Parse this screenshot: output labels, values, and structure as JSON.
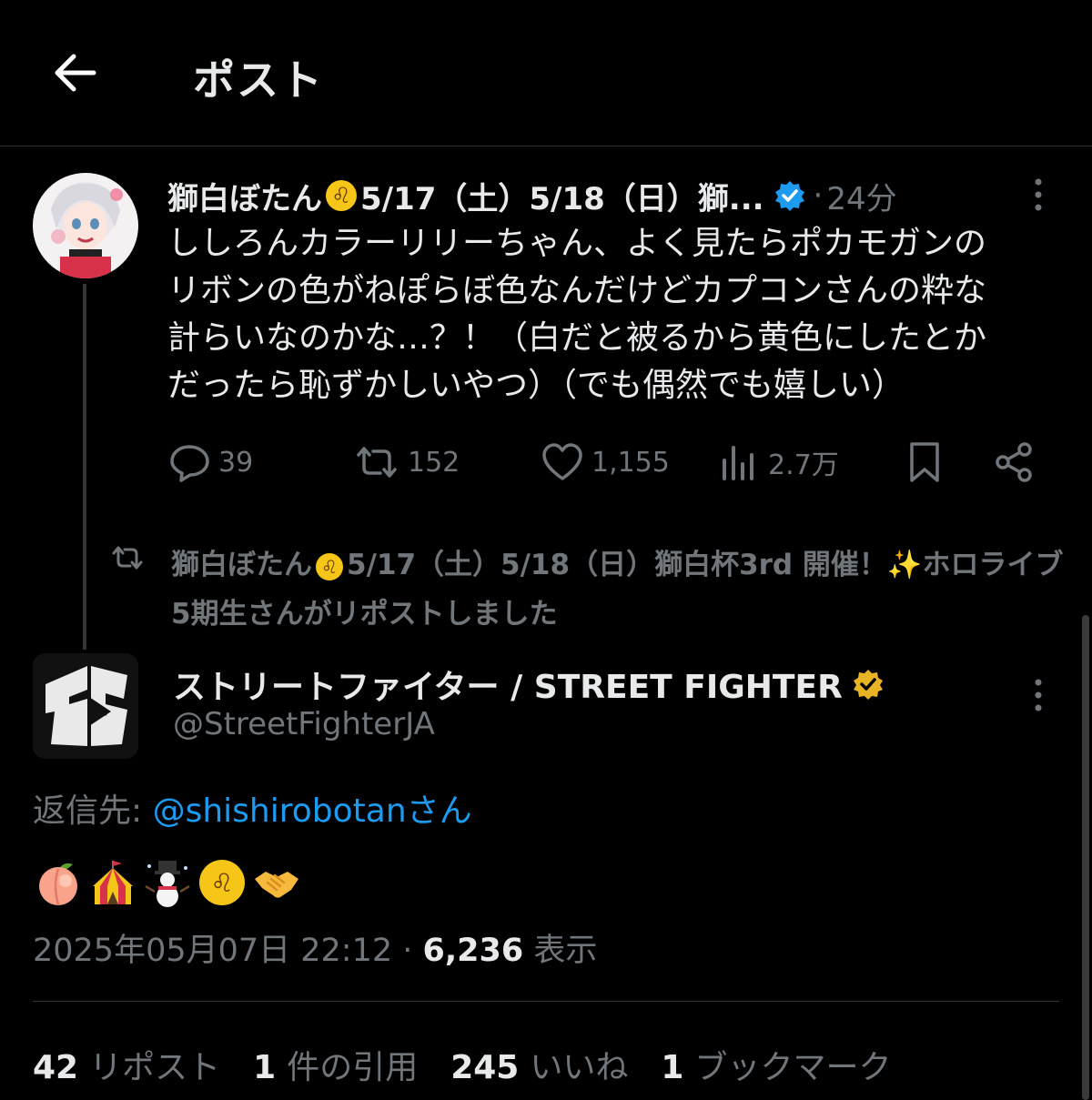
{
  "header": {
    "title": "ポスト",
    "back_icon": "arrow-left-icon"
  },
  "parent_post": {
    "author_name": "獅白ぼたん",
    "author_name_suffix": "5/17（土）5/18（日）獅...",
    "verified": true,
    "time": "24分",
    "text": "ししろんカラーリリーちゃん、よく見たらポカモガンの\nリボンの色がねぽらぼ色なんだけどカプコンさんの粋な\n計らいなのかな…？！（白だと被るから黄色にしたとか\nだったら恥ずかしいやつ）（でも偶然でも嬉しい）",
    "actions": {
      "replies": "39",
      "reposts": "152",
      "likes": "1,155",
      "views": "2.7万"
    }
  },
  "repost_notice": {
    "name": "獅白ぼたん",
    "text": "5/17（土）5/18（日）獅白杯3rd 開催！✨ホロライブ5期生さんがリポストしました"
  },
  "main_post": {
    "author_name": "ストリートファイター / STREET FIGHTER",
    "handle": "@StreetFighterJA",
    "verified_color": "#e8b424",
    "reply_to_label": "返信先:",
    "reply_to_handle": "@shishirobotan",
    "reply_to_suffix": "さん",
    "emojis": [
      "peach",
      "circus-tent",
      "snowman",
      "leo",
      "handshake"
    ],
    "timestamp": "2025年05月07日 22:12",
    "views_count": "6,236",
    "views_label": "表示",
    "stats": [
      {
        "count": "42",
        "label": "リポスト"
      },
      {
        "count": "1",
        "label": "件の引用"
      },
      {
        "count": "245",
        "label": "いいね"
      },
      {
        "count": "1",
        "label": "ブックマーク"
      }
    ]
  },
  "colors": {
    "background": "#000000",
    "text": "#e7e9ea",
    "muted": "#71767b",
    "link": "#1d9bf0",
    "verified_blue": "#1d9bf0"
  }
}
